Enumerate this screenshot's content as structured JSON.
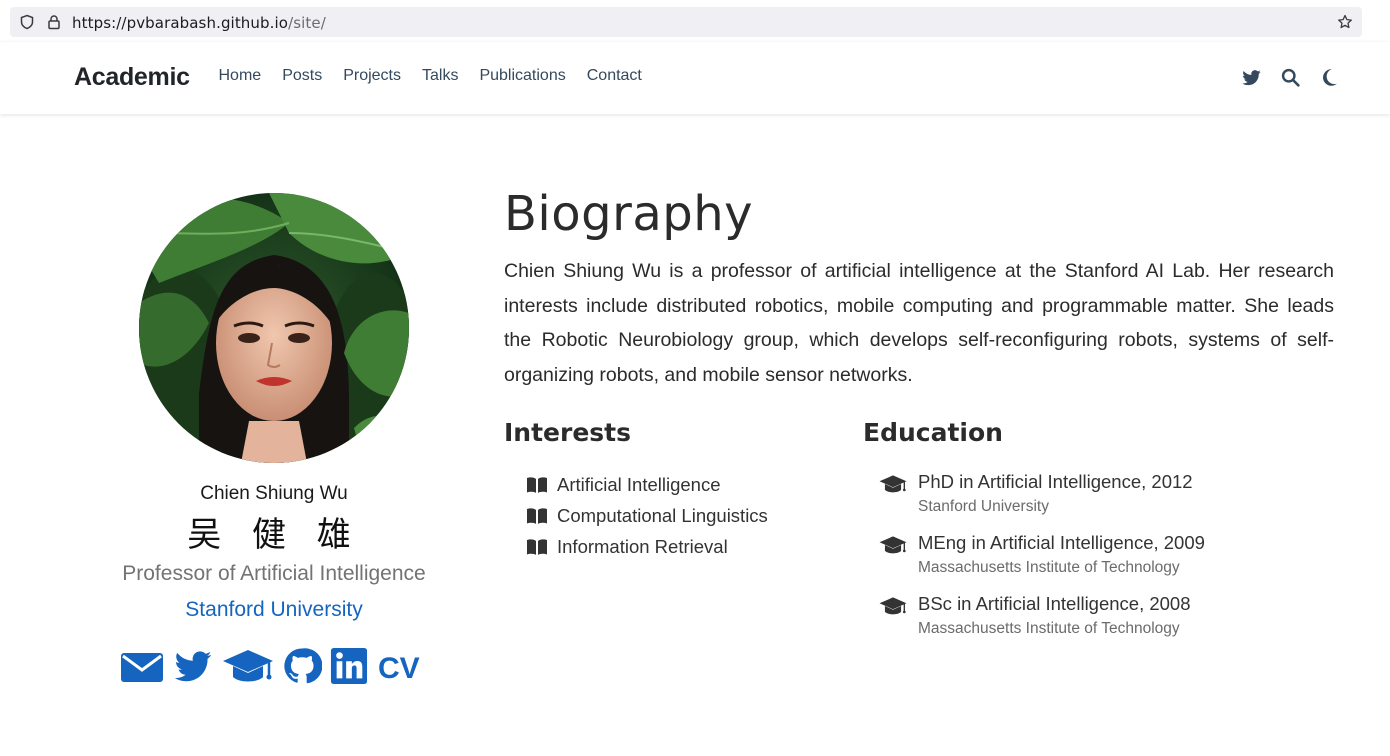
{
  "browser": {
    "url_host": "https://pvbarabash.github.io",
    "url_path": "/site/"
  },
  "navbar": {
    "brand": "Academic",
    "links": [
      "Home",
      "Posts",
      "Projects",
      "Talks",
      "Publications",
      "Contact"
    ]
  },
  "profile": {
    "name": "Chien Shiung Wu",
    "name_cn": "吴 健 雄",
    "role": "Professor of Artificial Intelligence",
    "organization": "Stanford University",
    "social_icons": [
      "envelope-icon",
      "twitter-icon",
      "graduation-cap-icon",
      "github-icon",
      "linkedin-icon"
    ],
    "cv_label": "CV",
    "accent_color": "#1565c0"
  },
  "biography": {
    "title": "Biography",
    "text": "Chien Shiung Wu is a professor of artificial intelligence at the Stanford AI Lab. Her research interests include distributed robotics, mobile computing and programmable matter. She leads the Robotic Neurobiology group, which develops self-reconfiguring robots, systems of self-organizing robots, and mobile sensor networks."
  },
  "interests": {
    "title": "Interests",
    "items": [
      "Artificial Intelligence",
      "Computational Linguistics",
      "Information Retrieval"
    ]
  },
  "education": {
    "title": "Education",
    "items": [
      {
        "course": "PhD in Artificial Intelligence, 2012",
        "institution": "Stanford University"
      },
      {
        "course": "MEng in Artificial Intelligence, 2009",
        "institution": "Massachusetts Institute of Technology"
      },
      {
        "course": "BSc in Artificial Intelligence, 2008",
        "institution": "Massachusetts Institute of Technology"
      }
    ]
  }
}
